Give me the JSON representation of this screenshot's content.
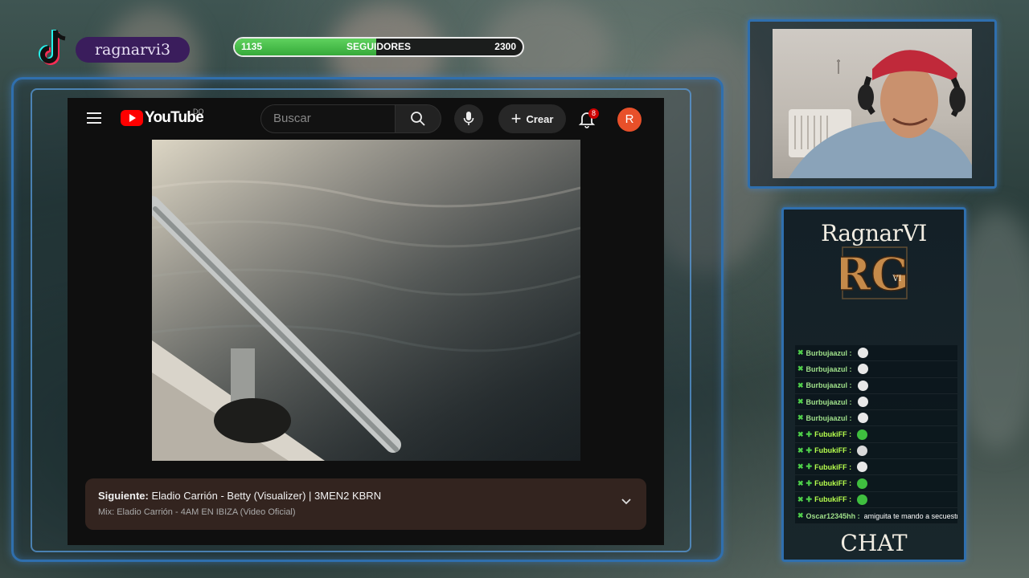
{
  "tiktok": {
    "username": "ragnarvi3"
  },
  "followers": {
    "current": "1135",
    "label": "SEGUIDORES",
    "goal": "2300",
    "progress_fraction": 0.493
  },
  "youtube": {
    "logo_text": "YouTube",
    "region": "DO",
    "search_placeholder": "Buscar",
    "create_label": "Crear",
    "notification_count": "8",
    "avatar_letter": "R",
    "up_next": {
      "prefix": "Siguiente:",
      "title": "Eladio Carrión - Betty (Visualizer) | 3MEN2 KBRN",
      "subtitle": "Mix: Eladio Carrión - 4AM EN IBIZA (Video Oficial)"
    }
  },
  "chat": {
    "brand": "RagnarVI",
    "logo_letters": "RG",
    "logo_sub": "VI",
    "footer": "CHAT",
    "messages": [
      {
        "user": "Burbujaazul :",
        "plus": false,
        "emoji_color": "#e8e8e8",
        "text": ""
      },
      {
        "user": "Burbujaazul :",
        "plus": false,
        "emoji_color": "#e8e8e8",
        "text": ""
      },
      {
        "user": "Burbujaazul :",
        "plus": false,
        "emoji_color": "#e8e8e8",
        "text": ""
      },
      {
        "user": "Burbujaazul :",
        "plus": false,
        "emoji_color": "#e8e8e8",
        "text": ""
      },
      {
        "user": "Burbujaazul :",
        "plus": false,
        "emoji_color": "#e8e8e8",
        "text": ""
      },
      {
        "user": "FubukiFF :",
        "plus": true,
        "emoji_color": "#3fbf3f",
        "text": ""
      },
      {
        "user": "FubukiFF :",
        "plus": true,
        "emoji_color": "#d9d9d9",
        "text": ""
      },
      {
        "user": "FubukiFF :",
        "plus": true,
        "emoji_color": "#e8e8e8",
        "text": ""
      },
      {
        "user": "FubukiFF :",
        "plus": true,
        "emoji_color": "#3fbf3f",
        "text": ""
      },
      {
        "user": "FubukiFF :",
        "plus": true,
        "emoji_color": "#3fbf3f",
        "text": ""
      },
      {
        "user": "Oscar12345hh :",
        "plus": false,
        "emoji_color": "",
        "text": "amiguita te mando a secuestrar"
      }
    ]
  }
}
